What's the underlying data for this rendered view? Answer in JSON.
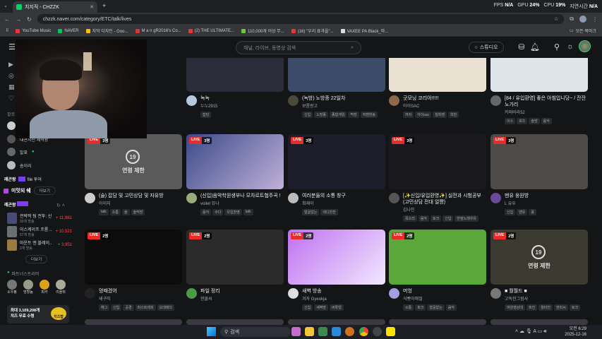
{
  "browser": {
    "tab_title": "치지직 - CHZZK",
    "url": "chzzk.naver.com/category/ETC/talk/lives",
    "new_tab": "+",
    "perf": {
      "fps_label": "FPS",
      "fps": "N/A",
      "gpu_label": "GPU",
      "gpu": "24%",
      "cpu_label": "CPU",
      "cpu": "19%",
      "latency_label": "지연시간",
      "latency": "N/A"
    },
    "bookmarks": [
      "YouTube Music",
      "NAVER",
      "자막 디자인 - Goo...",
      "M a n gR2016's Co...",
      "(2) THE ULTIMATE...",
      "110,000개 이상 무...",
      "(16) \"우리 표과을\"...",
      "VAXEE PA Black_마..."
    ],
    "all_bookmarks": "모든 북마크"
  },
  "header": {
    "search_placeholder": "채널, 라이브, 동영상 검색",
    "studio_label": "스튜디오"
  },
  "sidebar": {
    "following_label": "팔로우",
    "following": [
      "대관자신 제석왕",
      "발표",
      "솜이리"
    ],
    "badge_line": "file 투어",
    "channel_label": "미밋되 쉐",
    "more": "더보기",
    "categories": [
      {
        "title": "전략적 팀 전투: 신...",
        "sub": "33개 방송",
        "count": "+ 11,981"
      },
      {
        "title": "이스케이프 프롬 ...",
        "sub": "57개 방송",
        "count": "+ 10,521"
      },
      {
        "title": "마운트 앤 블레이...",
        "sub": "2개 방송",
        "count": "+ 3,951"
      }
    ],
    "more2": "더보기",
    "partners_label": "파트너스트리머",
    "partners": [
      "소우봉",
      "망할놈",
      "피카",
      "리올쥐"
    ],
    "banner_line1": "최대 3,109,208개",
    "banner_line2": "치즈 무료 수령",
    "banner_logo": "치즈팝"
  },
  "streams": [
    {
      "title": "녹녹",
      "channel": "누누2915",
      "tags": [
        "잡담"
      ]
    },
    {
      "title": "(녹방) 노방종 22일차",
      "channel": "보름왕고",
      "tags": [
        "신입",
        "노방종",
        "종합게임",
        "먹방",
        "여캠방송"
      ]
    },
    {
      "title": "굿모닝 코리아!!!!!",
      "channel": "아이SAC",
      "tags": [
        "여자",
        "아이sac",
        "침착맨",
        "학번"
      ]
    },
    {
      "title": "[84 / 유입환영] 좋은 아침입니당~ / 잔잔노가리",
      "channel": "키퍼바라52",
      "tags": [
        "이스",
        "포즈",
        "술방",
        "음악"
      ]
    },
    {
      "live": "LIVE",
      "viewers": "3명",
      "title": "(술) 잡담 및 고민상담 및 자유방",
      "channel": "아이지",
      "tags": [
        "talk",
        "소통",
        "술",
        "술먹방"
      ],
      "age": "19",
      "age_text": "연령 제한"
    },
    {
      "live": "LIVE",
      "viewers": "3명",
      "title": "(신입)음악학원생부나 모차르트협주곡 !",
      "channel": "voilet 뮤나",
      "tags": [
        "음악",
        "수다",
        "유입환영",
        "talk"
      ]
    },
    {
      "live": "LIVE",
      "viewers": "3명",
      "title": "여러분들의 소통 창구",
      "channel": "최재이",
      "tags": [
        "얼굴없는",
        "레디반찬"
      ]
    },
    {
      "live": "LIVE",
      "viewers": "3명",
      "title": "[✨신입/유입환영✨] 실전과 시험공부(고민상담 전대 얼쨩)",
      "channel": "김나인",
      "tags": [
        "목소리",
        "음악",
        "토크",
        "신입",
        "반말노래우유"
      ]
    },
    {
      "live": "LIVE",
      "viewers": "3명",
      "title": "멘유 웅원방",
      "channel": "L 유우",
      "tags": [
        "신입",
        "멘유",
        "롤"
      ]
    },
    {
      "live": "LIVE",
      "viewers": "2명",
      "title": "멍때겠어",
      "channel": "새구미",
      "tags": [
        "헤그",
        "신입",
        "공경",
        "퍼스트레피",
        "오데레다"
      ]
    },
    {
      "live": "LIVE",
      "viewers": "2명",
      "title": "파일 정리",
      "channel": "현물씨",
      "tags": []
    },
    {
      "live": "LIVE",
      "viewers": "2명",
      "title": "새벽 방송",
      "channel": "겨자 Gyeokja",
      "tags": [
        "신입",
        "새벽방",
        "버튜얼"
      ]
    },
    {
      "live": "LIVE",
      "viewers": "2명",
      "title": "머엉",
      "channel": "식빵이애절",
      "tags": [
        "소통",
        "토크",
        "얼굴없는",
        "음악"
      ]
    },
    {
      "live": "LIVE",
      "viewers": "2명",
      "title": "■ 월월드 ■",
      "channel": "고독한그림사",
      "tags": [
        "여원영상대",
        "퍼진",
        "월타천",
        "엔피씨",
        "토크"
      ],
      "age": "19",
      "age_text": "연령 제한"
    }
  ],
  "taskbar": {
    "search": "검색",
    "time": "오전 6:29",
    "date": "2025-12-16"
  }
}
